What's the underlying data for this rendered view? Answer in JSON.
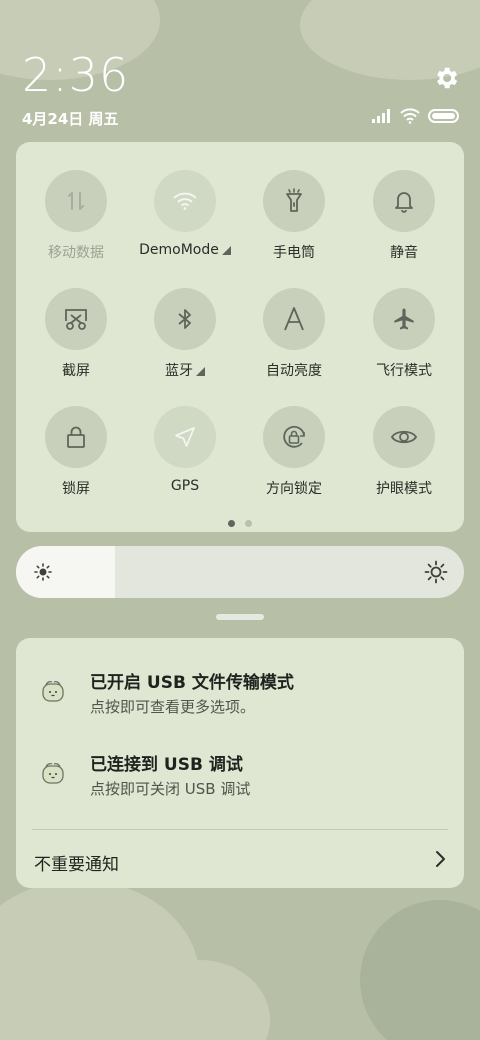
{
  "status": {
    "time": "2:36",
    "date": "4月24日 周五",
    "icons": [
      "signal-icon",
      "wifi-icon",
      "battery-icon"
    ]
  },
  "quick_settings": {
    "tiles": [
      {
        "label": "移动数据",
        "icon": "mobile-data-icon",
        "state": "disabled"
      },
      {
        "label": "DemoMode",
        "icon": "wifi-icon",
        "state": "active",
        "expandable": true
      },
      {
        "label": "手电筒",
        "icon": "flashlight-icon",
        "state": "off"
      },
      {
        "label": "静音",
        "icon": "bell-icon",
        "state": "off"
      },
      {
        "label": "截屏",
        "icon": "screenshot-icon",
        "state": "off"
      },
      {
        "label": "蓝牙",
        "icon": "bluetooth-icon",
        "state": "off",
        "expandable": true
      },
      {
        "label": "自动亮度",
        "icon": "auto-brightness-icon",
        "state": "off"
      },
      {
        "label": "飞行模式",
        "icon": "airplane-icon",
        "state": "off"
      },
      {
        "label": "锁屏",
        "icon": "lock-icon",
        "state": "off"
      },
      {
        "label": "GPS",
        "icon": "location-icon",
        "state": "active"
      },
      {
        "label": "方向锁定",
        "icon": "rotation-lock-icon",
        "state": "off"
      },
      {
        "label": "护眼模式",
        "icon": "eye-icon",
        "state": "off"
      }
    ],
    "page_count": 2,
    "current_page": 1
  },
  "brightness": {
    "level": 0.22
  },
  "notifications": [
    {
      "title": "已开启 USB 文件传输模式",
      "subtitle": "点按即可查看更多选项。",
      "icon": "app-mascot-icon"
    },
    {
      "title": "已连接到 USB 调试",
      "subtitle": "点按即可关闭 USB 调试",
      "icon": "app-mascot-icon"
    }
  ],
  "unimportant_label": "不重要通知",
  "colors": {
    "panel": "#dfe7d2",
    "tile": "#c8d0bc",
    "tile_active": "#d0d9c3",
    "wallpaper": "#b7bfa6",
    "icon": "#5e655a"
  }
}
